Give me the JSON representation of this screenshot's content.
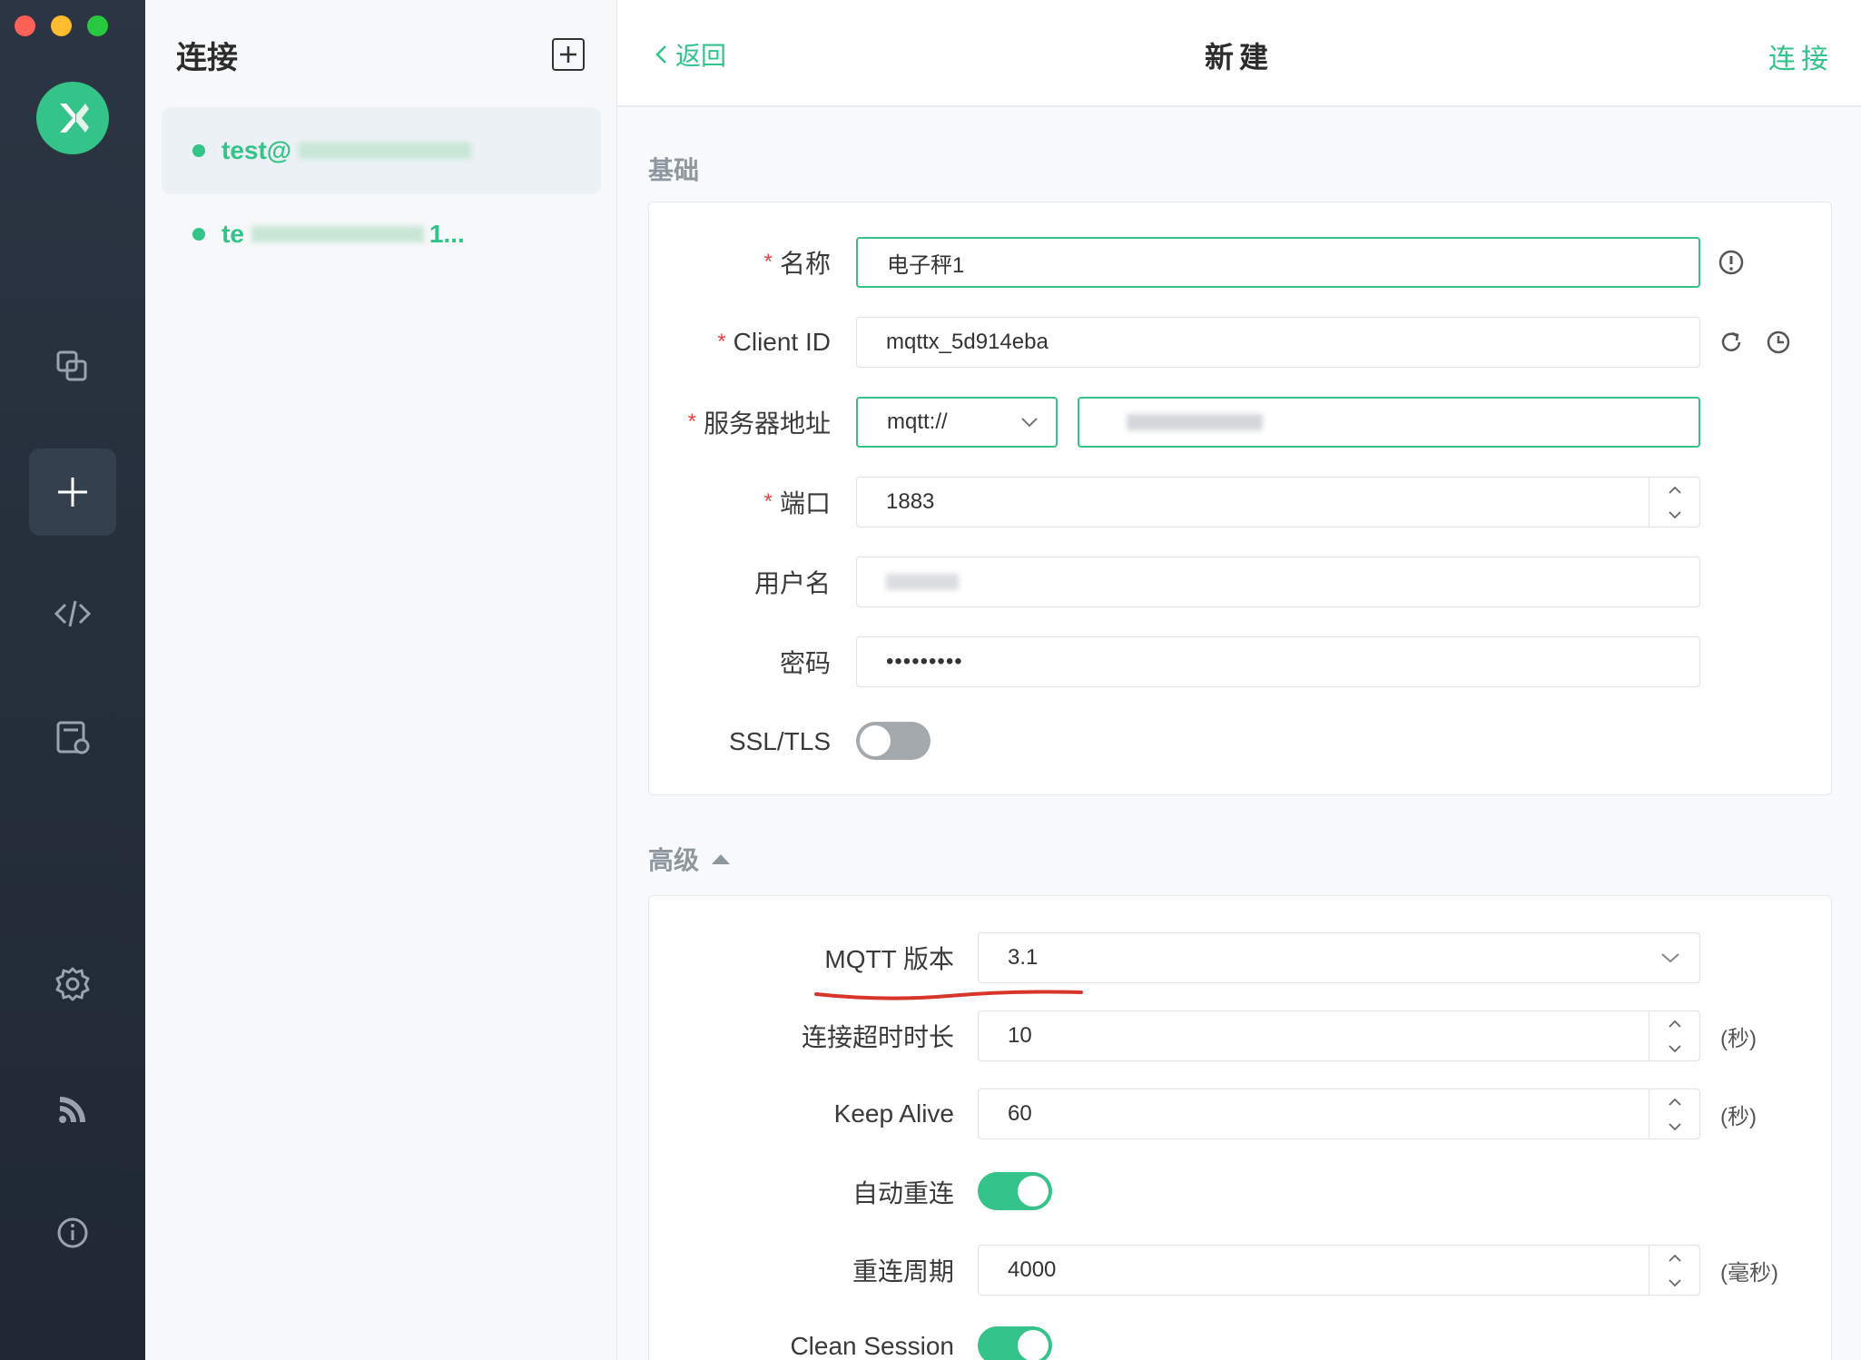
{
  "window": {
    "controls": [
      "close",
      "minimize",
      "maximize"
    ]
  },
  "rail": {
    "items": [
      {
        "name": "connections-icon"
      },
      {
        "name": "new-connection-icon",
        "active": true
      },
      {
        "name": "script-icon"
      },
      {
        "name": "log-icon"
      },
      {
        "name": "settings-icon"
      },
      {
        "name": "subscribe-icon"
      },
      {
        "name": "about-icon"
      }
    ],
    "accent": "#34c388"
  },
  "connections": {
    "title": "连接",
    "items": [
      {
        "label": "test@",
        "selected": true
      },
      {
        "label": "te",
        "suffix": "1...",
        "selected": false
      }
    ]
  },
  "header": {
    "back_label": "返回",
    "title": "新建",
    "connect_label": "连接"
  },
  "basic": {
    "section_title": "基础",
    "name": {
      "label": "名称",
      "value": "电子秤1"
    },
    "client_id": {
      "label": "Client ID",
      "value": "mqttx_5d914eba"
    },
    "server": {
      "label": "服务器地址",
      "protocol": "mqtt://",
      "host": ""
    },
    "port": {
      "label": "端口",
      "value": "1883"
    },
    "username": {
      "label": "用户名",
      "value": ""
    },
    "password": {
      "label": "密码",
      "value": "•••••••••"
    },
    "ssl": {
      "label": "SSL/TLS",
      "enabled": false
    }
  },
  "advanced": {
    "section_title": "高级",
    "mqtt_version": {
      "label": "MQTT 版本",
      "value": "3.1"
    },
    "connect_timeout": {
      "label": "连接超时时长",
      "value": "10",
      "unit": "(秒)"
    },
    "keep_alive": {
      "label": "Keep Alive",
      "value": "60",
      "unit": "(秒)"
    },
    "auto_reconnect": {
      "label": "自动重连",
      "enabled": true
    },
    "reconnect_period": {
      "label": "重连周期",
      "value": "4000",
      "unit": "(毫秒)"
    },
    "clean_session": {
      "label": "Clean Session",
      "enabled": true
    }
  },
  "annotation_color": "#d9362b"
}
